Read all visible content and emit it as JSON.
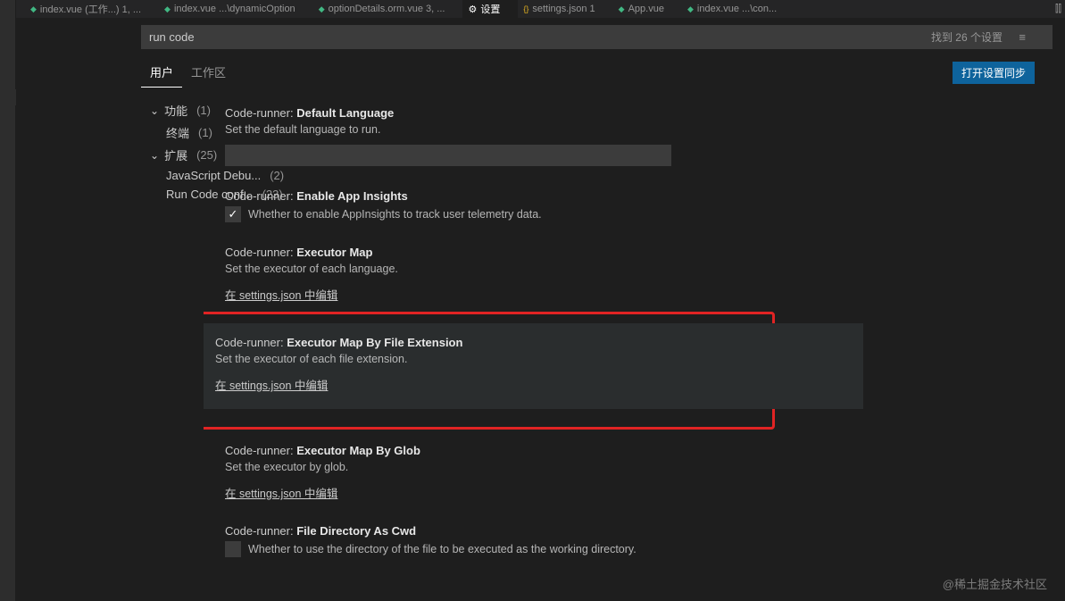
{
  "tabs": [
    {
      "icon": "vue",
      "label": "index.vue (工作...) 1, ..."
    },
    {
      "icon": "vue",
      "label": "index.vue ...\\dynamicOption"
    },
    {
      "icon": "vue",
      "label": "optionDetails.orm.vue 3, ..."
    },
    {
      "icon": "gear",
      "label": "设置",
      "active": true
    },
    {
      "icon": "json",
      "label": "settings.json 1"
    },
    {
      "icon": "vue",
      "label": "App.vue"
    },
    {
      "icon": "vue",
      "label": "index.vue ...\\con..."
    }
  ],
  "search": {
    "value": "run code",
    "count": "找到 26 个设置"
  },
  "scopes": {
    "user": "用户",
    "workspace": "工作区"
  },
  "sync_button": "打开设置同步",
  "sidebar": {
    "features": {
      "label": "功能",
      "count": "(1)"
    },
    "terminal": {
      "label": "终端",
      "count": "(1)"
    },
    "extensions": {
      "label": "扩展",
      "count": "(25)"
    },
    "js_debug": {
      "label": "JavaScript Debu...",
      "count": "(2)"
    },
    "run_code": {
      "label": "Run Code conf...",
      "count": "(23)"
    }
  },
  "settings": {
    "default_language": {
      "prefix": "Code-runner: ",
      "title": "Default Language",
      "desc": "Set the default language to run."
    },
    "app_insights": {
      "prefix": "Code-runner: ",
      "title": "Enable App Insights",
      "desc": "Whether to enable AppInsights to track user telemetry data.",
      "checked": true
    },
    "executor_map": {
      "prefix": "Code-runner: ",
      "title": "Executor Map",
      "desc": "Set the executor of each language.",
      "link": "在 settings.json 中编辑"
    },
    "executor_map_ext": {
      "prefix": "Code-runner: ",
      "title": "Executor Map By File Extension",
      "desc": "Set the executor of each file extension.",
      "link": "在 settings.json 中编辑"
    },
    "executor_map_glob": {
      "prefix": "Code-runner: ",
      "title": "Executor Map By Glob",
      "desc": "Set the executor by glob.",
      "link": "在 settings.json 中编辑"
    },
    "file_dir_cwd": {
      "prefix": "Code-runner: ",
      "title": "File Directory As Cwd",
      "desc": "Whether to use the directory of the file to be executed as the working directory.",
      "checked": false
    }
  },
  "watermark": "@稀土掘金技术社区"
}
